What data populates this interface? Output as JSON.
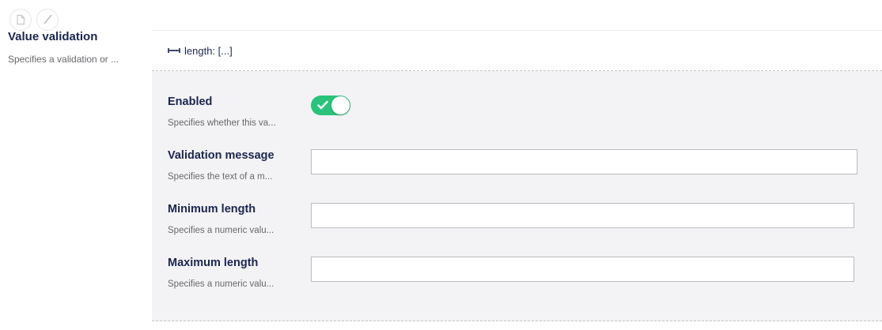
{
  "top_icons": [
    "document-icon",
    "brush-icon"
  ],
  "property": {
    "title": "Value validation",
    "description": "Specifies a validation or ..."
  },
  "panel": {
    "header_label": "length: [...]",
    "fields": {
      "enabled": {
        "label": "Enabled",
        "description": "Specifies whether this va...",
        "value": true
      },
      "validation_message": {
        "label": "Validation message",
        "description": "Specifies the text of a m...",
        "value": ""
      },
      "minimum_length": {
        "label": "Minimum length",
        "description": "Specifies a numeric valu...",
        "value": ""
      },
      "maximum_length": {
        "label": "Maximum length",
        "description": "Specifies a numeric valu...",
        "value": ""
      }
    }
  },
  "colors": {
    "accent_green": "#2bc37c",
    "text_primary": "#1b264f",
    "text_muted": "#68676b",
    "panel_bg": "#f3f3f5"
  }
}
